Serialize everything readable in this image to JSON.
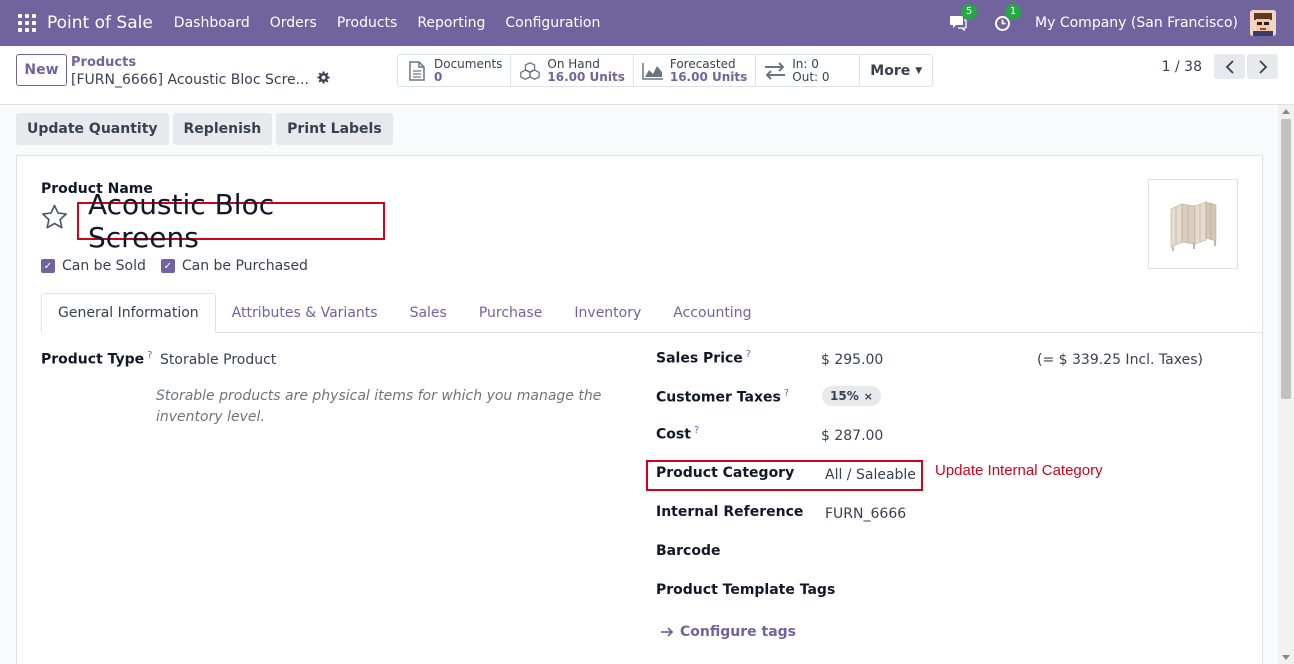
{
  "navbar": {
    "app_name": "Point of Sale",
    "menu": [
      "Dashboard",
      "Orders",
      "Products",
      "Reporting",
      "Configuration"
    ],
    "chat_badge": "5",
    "activity_badge": "1",
    "company": "My Company (San Francisco)",
    "bg_color": "#71639e"
  },
  "control_panel": {
    "new_label": "New",
    "breadcrumb_parent": "Products",
    "breadcrumb_current": "[FURN_6666] Acoustic Bloc Scre...",
    "smart_buttons": [
      {
        "label": "Documents",
        "value": "0",
        "icon": "document-icon"
      },
      {
        "label": "On Hand",
        "value": "16.00 Units",
        "icon": "cubes-icon"
      },
      {
        "label": "Forecasted",
        "value": "16.00 Units",
        "icon": "area-chart-icon"
      },
      {
        "label": "In: 0",
        "value": "Out: 0",
        "icon": "exchange-icon"
      }
    ],
    "more_label": "More",
    "pager": "1 / 38"
  },
  "status_buttons": [
    "Update Quantity",
    "Replenish",
    "Print Labels"
  ],
  "form": {
    "product_name_label": "Product Name",
    "product_name": "Acoustic Bloc Screens",
    "can_be_sold": "Can be Sold",
    "can_be_purchased": "Can be Purchased",
    "tabs": [
      "General Information",
      "Attributes & Variants",
      "Sales",
      "Purchase",
      "Inventory",
      "Accounting"
    ],
    "product_type_label": "Product Type",
    "product_type": "Storable Product",
    "product_type_help": "Storable products are physical items for which you manage the inventory level.",
    "sales_price_label": "Sales Price",
    "sales_price": "$ 295.00",
    "sales_price_incl": "(= $ 339.25 Incl. Taxes)",
    "customer_taxes_label": "Customer Taxes",
    "customer_tax_tag": "15%",
    "cost_label": "Cost",
    "cost": "$ 287.00",
    "category_label": "Product Category",
    "category": "All / Saleable",
    "internal_ref_label": "Internal Reference",
    "internal_ref": "FURN_6666",
    "barcode_label": "Barcode",
    "template_tags_label": "Product Template Tags",
    "configure_tags": "Configure tags",
    "help_mark": "?"
  },
  "annotation": "Update Internal Category"
}
